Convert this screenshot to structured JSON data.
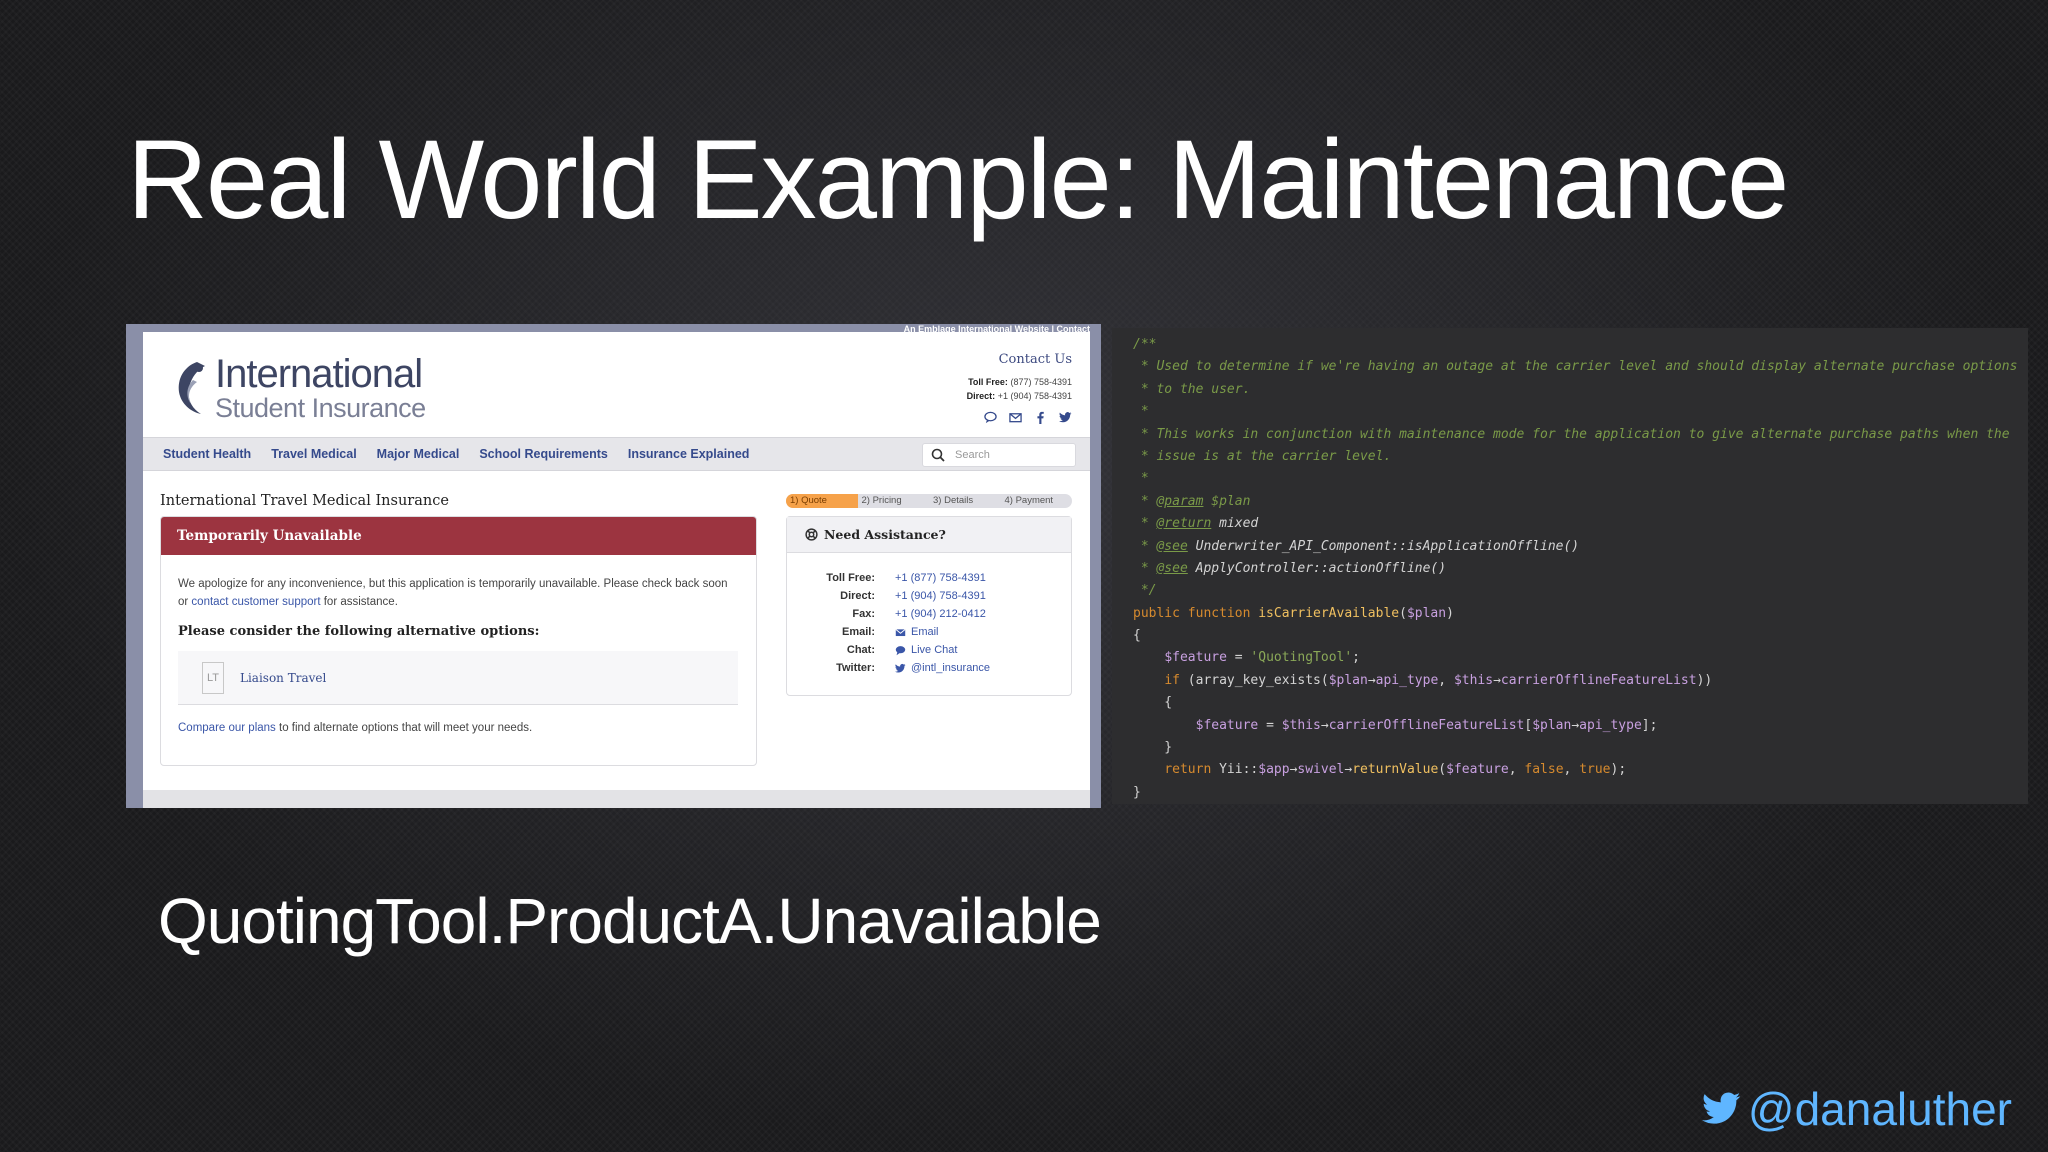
{
  "slide": {
    "title": "Real World Example: Maintenance",
    "feature_flag": "QuotingTool.ProductA.Unavailable",
    "twitter_handle": "@danaluther"
  },
  "website": {
    "top_strip": "An Emblage International Website | Contact",
    "logo": {
      "line1": "International",
      "line2": "Student Insurance"
    },
    "contact": {
      "title": "Contact Us",
      "toll_free_label": "Toll Free:",
      "toll_free": "(877) 758-4391",
      "direct_label": "Direct:",
      "direct": "+1 (904) 758-4391"
    },
    "nav": [
      "Student Health",
      "Travel Medical",
      "Major Medical",
      "School Requirements",
      "Insurance Explained"
    ],
    "search_placeholder": "Search",
    "page_heading": "International Travel Medical Insurance",
    "steps": [
      "1) Quote",
      "2) Pricing",
      "3) Details",
      "4) Payment"
    ],
    "alert": {
      "title": "Temporarily Unavailable",
      "message_pre": "We apologize for any inconvenience, but this application is temporarily unavailable. Please check back soon or ",
      "message_link": "contact customer support",
      "message_post": " for assistance.",
      "alternatives_title": "Please consider the following alternative options:",
      "alternative_logo": "LT",
      "alternative_label": "Liaison Travel",
      "footer_link": "Compare our plans",
      "footer_text": " to find alternate options that will meet your needs."
    },
    "assistance": {
      "title": "Need Assistance?",
      "rows": [
        {
          "key": "Toll Free:",
          "value": "+1 (877) 758-4391",
          "icon": ""
        },
        {
          "key": "Direct:",
          "value": "+1 (904) 758-4391",
          "icon": ""
        },
        {
          "key": "Fax:",
          "value": "+1 (904) 212-0412",
          "icon": ""
        },
        {
          "key": "Email:",
          "value": "Email",
          "icon": "envelope-icon"
        },
        {
          "key": "Chat:",
          "value": "Live Chat",
          "icon": "chat-icon"
        },
        {
          "key": "Twitter:",
          "value": "@intl_insurance",
          "icon": "twitter-icon"
        }
      ]
    }
  },
  "code": {
    "lines": [
      [
        [
          "c-com",
          "/**"
        ]
      ],
      [
        [
          "c-com",
          " * Used to determine if we're having an outage at the carrier level and should display alternate purchase options"
        ]
      ],
      [
        [
          "c-com",
          " * to the user."
        ]
      ],
      [
        [
          "c-com",
          " *"
        ]
      ],
      [
        [
          "c-com",
          " * This works in conjunction with maintenance mode for the application to give alternate purchase paths when the"
        ]
      ],
      [
        [
          "c-com",
          " * issue is at the carrier level."
        ]
      ],
      [
        [
          "c-com",
          " *"
        ]
      ],
      [
        [
          "c-com",
          " * "
        ],
        [
          "c-tag",
          "@param"
        ],
        [
          "c-com",
          " $plan"
        ]
      ],
      [
        [
          "c-com",
          " * "
        ],
        [
          "c-tag",
          "@return"
        ],
        [
          "c-type",
          " mixed"
        ]
      ],
      [
        [
          "c-com",
          " * "
        ],
        [
          "c-tag",
          "@see"
        ],
        [
          "c-type",
          " Underwriter_API_Component::isApplicationOffline()"
        ]
      ],
      [
        [
          "c-com",
          " * "
        ],
        [
          "c-tag",
          "@see"
        ],
        [
          "c-type",
          " ApplyController::actionOffline()"
        ]
      ],
      [
        [
          "c-com",
          " */"
        ]
      ],
      [
        [
          "c-kw",
          "public function "
        ],
        [
          "c-fn",
          "isCarrierAvailable"
        ],
        [
          "c-plain",
          "("
        ],
        [
          "c-var",
          "$plan"
        ],
        [
          "c-plain",
          ")"
        ]
      ],
      [
        [
          "c-plain",
          "{"
        ]
      ],
      [
        [
          "c-plain",
          "    "
        ],
        [
          "c-var",
          "$feature"
        ],
        [
          "c-plain",
          " = "
        ],
        [
          "c-str",
          "'QuotingTool'"
        ],
        [
          "c-plain",
          ";"
        ]
      ],
      [
        [
          "c-plain",
          "    "
        ],
        [
          "c-kw",
          "if"
        ],
        [
          "c-plain",
          " (array_key_exists("
        ],
        [
          "c-var",
          "$plan"
        ],
        [
          "c-plain",
          "→"
        ],
        [
          "c-prop",
          "api_type"
        ],
        [
          "c-plain",
          ", "
        ],
        [
          "c-var",
          "$this"
        ],
        [
          "c-plain",
          "→"
        ],
        [
          "c-prop",
          "carrierOfflineFeatureList"
        ],
        [
          "c-plain",
          "))"
        ]
      ],
      [
        [
          "c-plain",
          "    {"
        ]
      ],
      [
        [
          "c-plain",
          "        "
        ],
        [
          "c-var",
          "$feature"
        ],
        [
          "c-plain",
          " = "
        ],
        [
          "c-var",
          "$this"
        ],
        [
          "c-plain",
          "→"
        ],
        [
          "c-prop",
          "carrierOfflineFeatureList"
        ],
        [
          "c-plain",
          "["
        ],
        [
          "c-var",
          "$plan"
        ],
        [
          "c-plain",
          "→"
        ],
        [
          "c-prop",
          "api_type"
        ],
        [
          "c-plain",
          "];"
        ]
      ],
      [
        [
          "c-plain",
          "    }"
        ]
      ],
      [
        [
          "c-plain",
          "    "
        ],
        [
          "c-kw",
          "return"
        ],
        [
          "c-plain",
          " Yii::"
        ],
        [
          "c-var",
          "$app"
        ],
        [
          "c-plain",
          "→"
        ],
        [
          "c-prop",
          "swivel"
        ],
        [
          "c-plain",
          "→"
        ],
        [
          "c-fn",
          "returnValue"
        ],
        [
          "c-plain",
          "("
        ],
        [
          "c-var",
          "$feature"
        ],
        [
          "c-plain",
          ", "
        ],
        [
          "c-kw",
          "false"
        ],
        [
          "c-plain",
          ", "
        ],
        [
          "c-kw",
          "true"
        ],
        [
          "c-plain",
          ");"
        ]
      ],
      [
        [
          "c-plain",
          "}"
        ]
      ]
    ]
  },
  "colors": {
    "alert_header": "#9c3440",
    "nav_link": "#354a8c",
    "link": "#3a56a8",
    "step_active": "#f6a24a",
    "twitter_blue": "#5fb6ff",
    "code_background": "#2d2d2f"
  }
}
